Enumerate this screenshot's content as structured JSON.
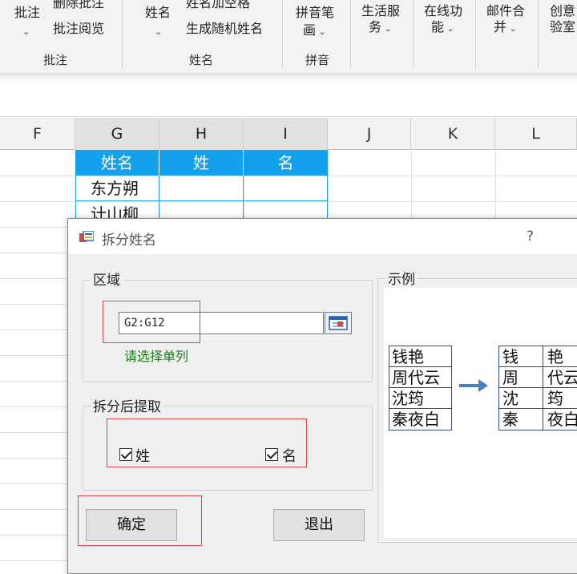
{
  "ribbon": {
    "items": [
      {
        "label": "批注",
        "has_dropdown": true
      },
      {
        "label": "删除批注"
      },
      {
        "label": "批注阅览"
      },
      {
        "label": "姓名",
        "has_dropdown": true
      },
      {
        "label": "姓名加空格"
      },
      {
        "label": "生成随机姓名"
      },
      {
        "label": "拼音笔画",
        "line1": "拼音笔",
        "line2": "画",
        "has_dropdown": true
      },
      {
        "label": "生活服务",
        "line1": "生活服",
        "line2": "务",
        "has_dropdown": true
      },
      {
        "label": "在线功能",
        "line1": "在线功",
        "line2": "能",
        "has_dropdown": true
      },
      {
        "label": "邮件合并",
        "line1": "邮件合",
        "line2": "并",
        "has_dropdown": true
      },
      {
        "label": "创意实验室",
        "line1": "创意",
        "line2": "验室"
      }
    ],
    "groups": [
      "批注",
      "姓名",
      "拼音"
    ]
  },
  "sheet": {
    "columns": [
      "F",
      "G",
      "H",
      "I",
      "J",
      "K",
      "L"
    ],
    "headers": [
      "姓名",
      "姓",
      "名"
    ],
    "rows": [
      "东方朔",
      "计山柳"
    ]
  },
  "dialog": {
    "title": "拆分姓名",
    "help": "?",
    "region_label": "区域",
    "range_value": "G2:G12",
    "hint": "请选择单列",
    "extract_label": "拆分后提取",
    "option_surname": "姓",
    "option_given": "名",
    "surname_checked": true,
    "given_checked": true,
    "example_label": "示例",
    "example_names": [
      "钱艳",
      "周代云",
      "沈筠",
      "秦夜白"
    ],
    "example_split": [
      [
        "钱",
        "艳"
      ],
      [
        "周",
        "代云"
      ],
      [
        "沈",
        "筠"
      ],
      [
        "秦",
        "夜白"
      ]
    ],
    "ok": "确定",
    "exit": "退出"
  },
  "colors": {
    "header_blue": "#13a1ec",
    "hint_green": "#1a7a1a",
    "highlight_red": "#e0474c",
    "arrow_blue": "#4a7fc1"
  }
}
